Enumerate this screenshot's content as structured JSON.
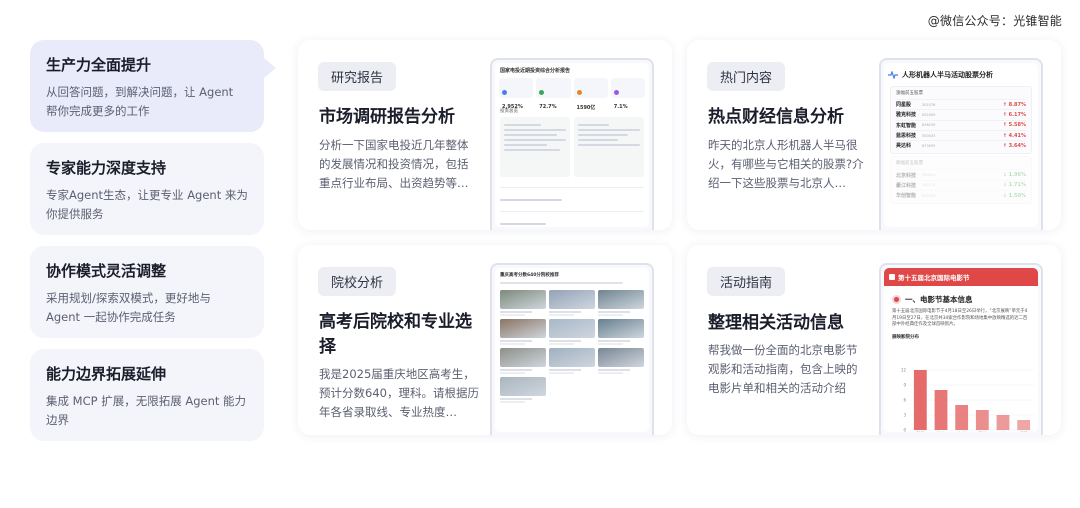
{
  "watermark": "@微信公众号：光锥智能",
  "nav": {
    "items": [
      {
        "title": "生产力全面提升",
        "desc": "从回答问题，到解决问题，让 Agent 帮你完成更多的工作"
      },
      {
        "title": "专家能力深度支持",
        "desc": "专家Agent生态，让更专业 Agent 来为你提供服务"
      },
      {
        "title": "协作模式灵活调整",
        "desc": "采用规划/探索双模式，更好地与 Agent 一起协作完成任务"
      },
      {
        "title": "能力边界拓展延伸",
        "desc": "集成 MCP 扩展，无限拓展 Agent 能力边界"
      }
    ]
  },
  "cards": [
    {
      "tag": "研究报告",
      "title": "市场调研报告分析",
      "desc": "分析一下国家电投近几年整体的发展情况和投资情况，包括重点行业布局、出资趋势等…"
    },
    {
      "tag": "热门内容",
      "title": "热点财经信息分析",
      "desc": "昨天的北京人形机器人半马很火，有哪些与它相关的股票?介绍一下这些股票与北京人…"
    },
    {
      "tag": "院校分析",
      "title": "高考后院校和专业选择",
      "desc": "我是2025届重庆地区高考生，预计分数640，理科。请根据历年各省录取线、专业热度…"
    },
    {
      "tag": "活动指南",
      "title": "整理相关活动信息",
      "desc": "帮我做一份全面的北京电影节观影和活动指南，包含上映的电影片单和相关的活动介绍"
    }
  ],
  "preview1": {
    "title": "国家电投近期投资综合分析报告",
    "stats": [
      "2,952%",
      "72.7%",
      "1590亿",
      "7.1%"
    ],
    "stat_colors": [
      "#4a7cf0",
      "#3aa855",
      "#e08a2c",
      "#9d5ae0"
    ],
    "section": "投资总览"
  },
  "preview2": {
    "title": "人形机器人半马活动股票分析",
    "subtitle": "涨幅前五股票",
    "up": [
      {
        "name": "同星股",
        "code": "301076",
        "pct": "↑ 8.87%"
      },
      {
        "name": "雅克科技",
        "code": "002409",
        "pct": "↑ 6.17%"
      },
      {
        "name": "东虹智能",
        "code": "836239",
        "pct": "↑ 5.58%"
      },
      {
        "name": "蓝思科技",
        "code": "300433",
        "pct": "↑ 4.41%"
      },
      {
        "name": "昊达科",
        "code": "873593",
        "pct": "↑ 3.64%"
      }
    ],
    "down_title": "跌幅前五股票",
    "down": [
      {
        "name": "北京科技",
        "code": "300014",
        "pct": "↓ 1.96%"
      },
      {
        "name": "豪江科技",
        "code": "301170",
        "pct": "↓ 1.71%"
      },
      {
        "name": "华创智能",
        "code": "002229",
        "pct": "↓ 1.50%"
      }
    ]
  },
  "preview3": {
    "title": "重庆高考分数640分院校推荐",
    "images": [
      "#7c8a7a",
      "#93a2b8",
      "#6f8590",
      "#8a7464",
      "#a8b7c8",
      "#66808f",
      "#8d8f88",
      "#9fb0c0",
      "#7a8695",
      "#aab6bf"
    ]
  },
  "preview4": {
    "header": "第十五届北京国际电影节",
    "section": "一、电影节基本信息",
    "text": "第十五届北京国际电影节于4月18日至26日举行，“北京展映”单元于4月19日至27日，在北京共34家合作影院和场地集中放映精选的近二百部中外经典佳作及全球首映新片。",
    "chart_label": "展映影院分布"
  },
  "chart_data": {
    "type": "bar",
    "ylabel": "展映影院分布",
    "ylim": [
      0,
      12
    ],
    "yticks": [
      0,
      3,
      6,
      9,
      12
    ],
    "categories": [
      "朝阳",
      "海淀",
      "东城",
      "西城",
      "丰台",
      "怀柔"
    ],
    "values": [
      12,
      8,
      5,
      4,
      3,
      2
    ],
    "color": "#e56a6a"
  }
}
